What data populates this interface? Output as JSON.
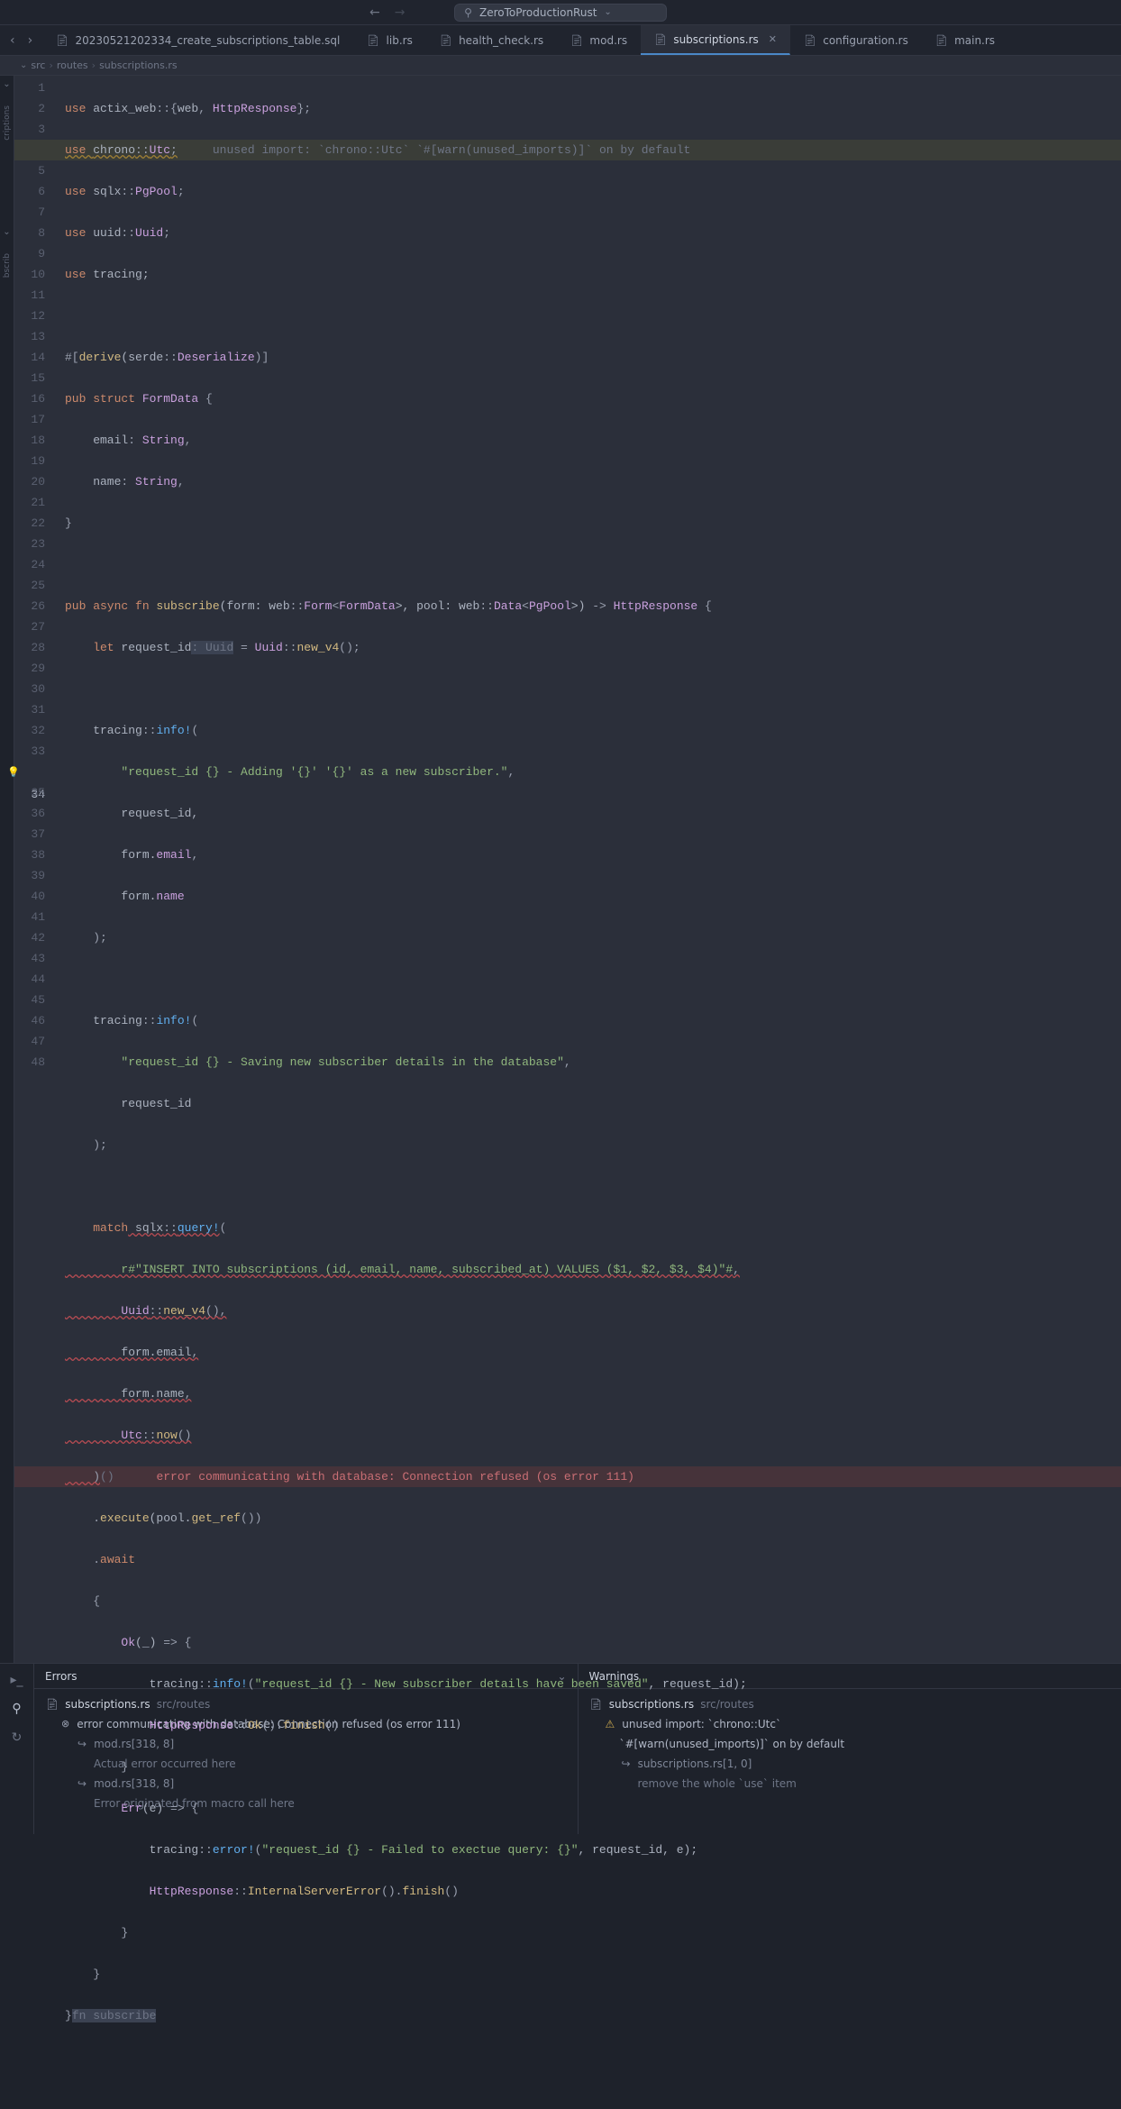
{
  "titlebar": {
    "project": "ZeroToProductionRust"
  },
  "tabs": {
    "items": [
      {
        "label": "20230521202334_create_subscriptions_table.sql"
      },
      {
        "label": "lib.rs"
      },
      {
        "label": "health_check.rs"
      },
      {
        "label": "mod.rs"
      },
      {
        "label": "subscriptions.rs"
      },
      {
        "label": "configuration.rs"
      },
      {
        "label": "main.rs"
      }
    ]
  },
  "breadcrumb": {
    "a": "src",
    "b": "routes",
    "c": "subscriptions.rs"
  },
  "rail": {
    "a": "criptions",
    "b": "bscrib"
  },
  "line_count": 48,
  "highlight_line": 34,
  "code": {
    "l1a": "use",
    "l1b": " actix_web",
    "l1c": "::{",
    "l1d": "web",
    "l1e": ", ",
    "l1f": "HttpResponse",
    "l1g": "};",
    "l2a": "use ",
    "l2b": "chrono",
    "l2c": "::",
    "l2d": "Utc",
    "l2e": ";",
    "l2h": "unused import: `chrono::Utc` `#[warn(unused_imports)]` on by default",
    "l3a": "use",
    "l3b": " sqlx",
    "l3c": "::",
    "l3d": "PgPool",
    "l3e": ";",
    "l4a": "use",
    "l4b": " uuid",
    "l4c": "::",
    "l4d": "Uuid",
    "l4e": ";",
    "l5a": "use",
    "l5b": " tracing;",
    "l7a": "#[",
    "l7b": "derive",
    "l7c": "(serde",
    "l7d": "::",
    "l7e": "Deserialize",
    "l7f": ")]",
    "l8a": "pub struct",
    "l8b": " FormData",
    " l8c": " {",
    "l9a": "    email",
    "l9b": ": ",
    "l9c": "String",
    "l9d": ",",
    "l10a": "    name",
    "l10b": ": ",
    "l10c": "String",
    "l10d": ",",
    "l11a": "}",
    "l13a": "pub async fn",
    "l13b": " subscribe",
    "l13c": "(form: ",
    "l13d": "web",
    "l13e": "::",
    "l13f": "Form",
    "l13g": "<",
    "l13h": "FormData",
    "l13i": ">, pool: ",
    "l13j": "web",
    "l13k": "::",
    "l13l": "Data",
    "l13m": "<",
    "l13n": "PgPool",
    "l13o": ">) ",
    "l13p": "->",
    "l13q": " HttpResponse",
    " l13r": " {",
    "l14a": "    let",
    "l14b": " request_id",
    "l14c": ": Uuid",
    "l14d": " = ",
    "l14e": "Uuid",
    "l14f": "::",
    "l14g": "new_v4",
    "l14h": "();",
    "l16a": "    tracing",
    "l16b": "::",
    "l16c": "info!",
    "l16d": "(",
    "l17a": "        \"request_id {} - Adding '{}' '{}' as a new subscriber.\"",
    "l17b": ",",
    "l18a": "        request_id,",
    "l19a": "        form.",
    "l19b": "email",
    "l19c": ",",
    "l20a": "        form.",
    "l20b": "name",
    "l21a": "    );",
    "l23a": "    tracing",
    "l23b": "::",
    "l23c": "info!",
    "l23d": "(",
    "l24a": "        \"request_id {} - Saving new subscriber details in the database\"",
    "l24b": ",",
    "l25a": "        request_id",
    "l26a": "    );",
    "l28a": "    match",
    "l28b": " sqlx",
    "l28c": "::",
    "l28d": "query!",
    "l28e": "(",
    "l29a": "        r#\"INSERT INTO subscriptions (id, email, name, subscribed_at) VALUES ($1, $2, $3, $4)\"#",
    "l29b": ",",
    "l30a": "        Uuid",
    "l30b": "::",
    "l30c": "new_v4",
    "l30d": "()",
    "l30e": ",",
    "l31a": "        form.email",
    "l31b": ",",
    "l32a": "        form.name",
    "l32b": ",",
    "l33a": "        Utc",
    "l33b": "::",
    "l33c": "now",
    "l33d": "()",
    "l34a": "    )",
    "l34b": "()",
    "l34h": "error communicating with database: Connection refused (os error 111)",
    "l35a": "    .",
    "l35b": "execute",
    "l35c": "(pool.",
    "l35d": "get_ref",
    "l35e": "())",
    "l36a": "    .",
    "l36b": "await",
    "l37a": "    {",
    "l38a": "        Ok",
    "l38b": "(_) ",
    "l38c": "=>",
    "l38d": " {",
    "l39a": "            tracing",
    "l39b": "::",
    "l39c": "info!",
    "l39d": "(",
    "l39e": "\"request_id {} - New subscriber details have been saved\"",
    "l39f": ", request_id);",
    "l40a": "            HttpResponse",
    "l40b": "::",
    "l40c": "Ok",
    "l40d": "().",
    "l40e": "finish",
    "l40f": "()",
    "l41a": "        }",
    "l42a": "        Err",
    "l42b": "(e) ",
    "l42c": "=>",
    "l42d": " {",
    "l43a": "            tracing",
    "l43b": "::",
    "l43c": "error!",
    "l43d": "(",
    "l43e": "\"request_id {} - Failed to exectue query: {}\"",
    "l43f": ", request_id, e);",
    "l44a": "            HttpResponse",
    "l44b": "::",
    "l44c": "InternalServerError",
    "l44d": "().",
    "l44e": "finish",
    "l44f": "()",
    "l45a": "        }",
    "l46a": "    }",
    "l47a": "}",
    "l47b": "fn subscribe"
  },
  "panels": {
    "errors": {
      "title": "Errors",
      "file": "subscriptions.rs",
      "path": "src/routes",
      "msg": "error communicating with database: Connection refused (os error 111)",
      "loc1": "mod.rs[318, 8]",
      "note1": "Actual error occurred here",
      "loc2": "mod.rs[318, 8]",
      "note2": "Error originated from macro call here"
    },
    "warnings": {
      "title": "Warnings",
      "file": "subscriptions.rs",
      "path": "src/routes",
      "msg": "unused import: `chrono::Utc`",
      "msg2": "`#[warn(unused_imports)]` on by default",
      "loc1": "subscriptions.rs[1, 0]",
      "note1": "remove the whole `use` item"
    }
  }
}
